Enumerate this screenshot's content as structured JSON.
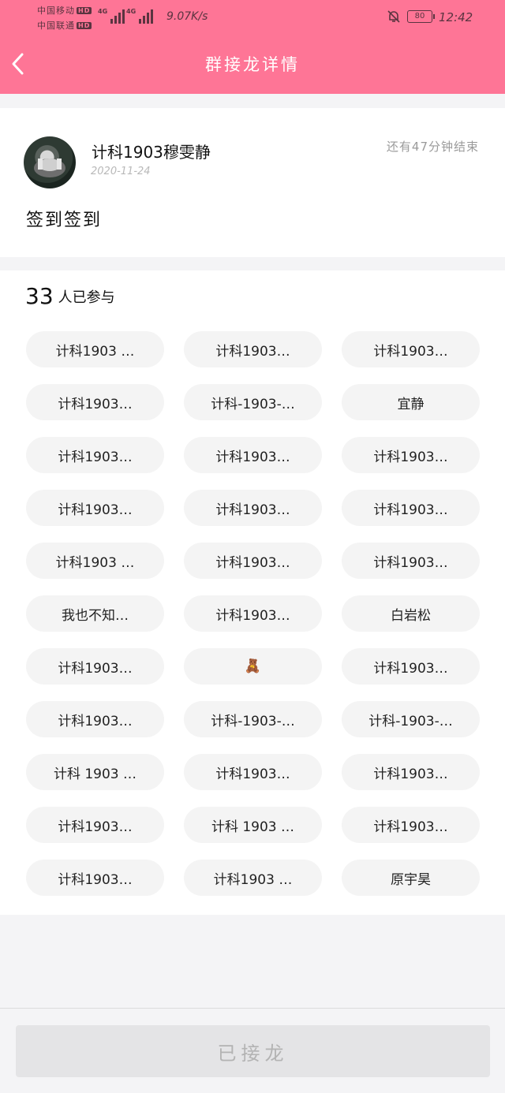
{
  "status_bar": {
    "carrier_1": "中国移动",
    "carrier_2": "中国联通",
    "hd": "HD",
    "network": "4G",
    "speed": "9.07K/s",
    "battery": "80",
    "time": "12:42"
  },
  "header": {
    "title": "群接龙详情"
  },
  "post": {
    "author": "计科1903穆雯静",
    "date": "2020-11-24",
    "time_remaining": "还有47分钟结束",
    "content": "签到签到"
  },
  "participants": {
    "count": "33",
    "count_suffix": "人已参与",
    "names": [
      "计科1903 …",
      "计科1903…",
      "计科1903…",
      "计科1903…",
      "计科-1903-…",
      "宜静",
      "计科1903…",
      "计科1903…",
      "计科1903…",
      "计科1903…",
      "计科1903…",
      "计科1903…",
      "计科1903 …",
      "计科1903…",
      "计科1903…",
      "我也不知…",
      "计科1903…",
      "白岩松",
      "计科1903…",
      "🧸",
      "计科1903…",
      "计科1903…",
      "计科-1903-…",
      "计科-1903-…",
      "计科 1903 …",
      "计科1903…",
      "计科1903…",
      "计科1903…",
      "计科 1903 …",
      "计科1903…",
      "计科1903…",
      "计科1903 …",
      "原宇昊"
    ]
  },
  "footer": {
    "button_label": "已接龙"
  },
  "colors": {
    "accent": "#fe7596",
    "chip_bg": "#f4f4f4",
    "disabled_button": "#e4e4e6"
  }
}
